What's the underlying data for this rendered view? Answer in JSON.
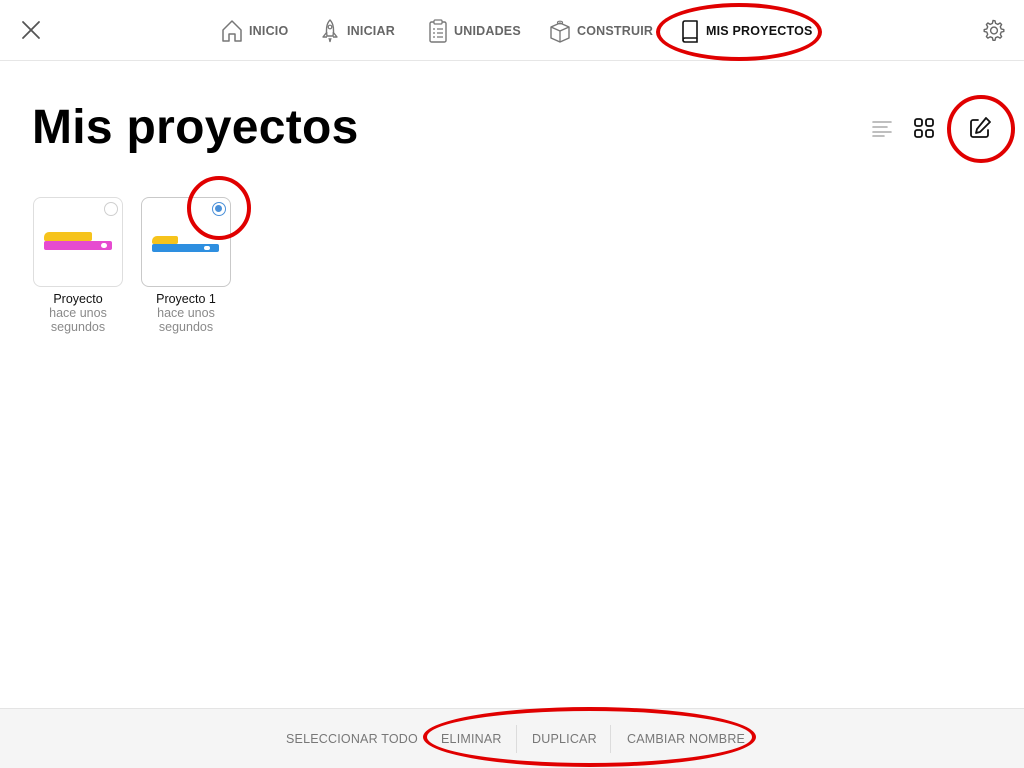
{
  "topbar": {
    "nav": [
      {
        "label": "INICIO",
        "icon": "home-icon"
      },
      {
        "label": "INICIAR",
        "icon": "rocket-icon"
      },
      {
        "label": "UNIDADES",
        "icon": "clipboard-list-icon"
      },
      {
        "label": "CONSTRUIR",
        "icon": "brick-icon"
      },
      {
        "label": "MIS PROYECTOS",
        "icon": "book-icon",
        "active": true
      }
    ],
    "close_icon": "close-icon",
    "settings_icon": "gear-icon"
  },
  "main": {
    "title": "Mis proyectos",
    "view_controls": [
      "list-view-icon",
      "grid-view-icon",
      "edit-icon"
    ],
    "projects": [
      {
        "name": "Proyecto",
        "time": "hace unos segundos",
        "selected": false
      },
      {
        "name": "Proyecto 1",
        "time": "hace unos segundos",
        "selected": true
      }
    ]
  },
  "bottombar": {
    "select_all": "SELECCIONAR TODO",
    "delete": "ELIMINAR",
    "duplicate": "DUPLICAR",
    "rename": "CAMBIAR NOMBRE"
  },
  "colors": {
    "annotation": "#e00000",
    "selected_radio": "#4a90d9",
    "block_yellow": "#f6c31c",
    "block_pink": "#e64bd0",
    "block_blue": "#2e8fe0"
  }
}
